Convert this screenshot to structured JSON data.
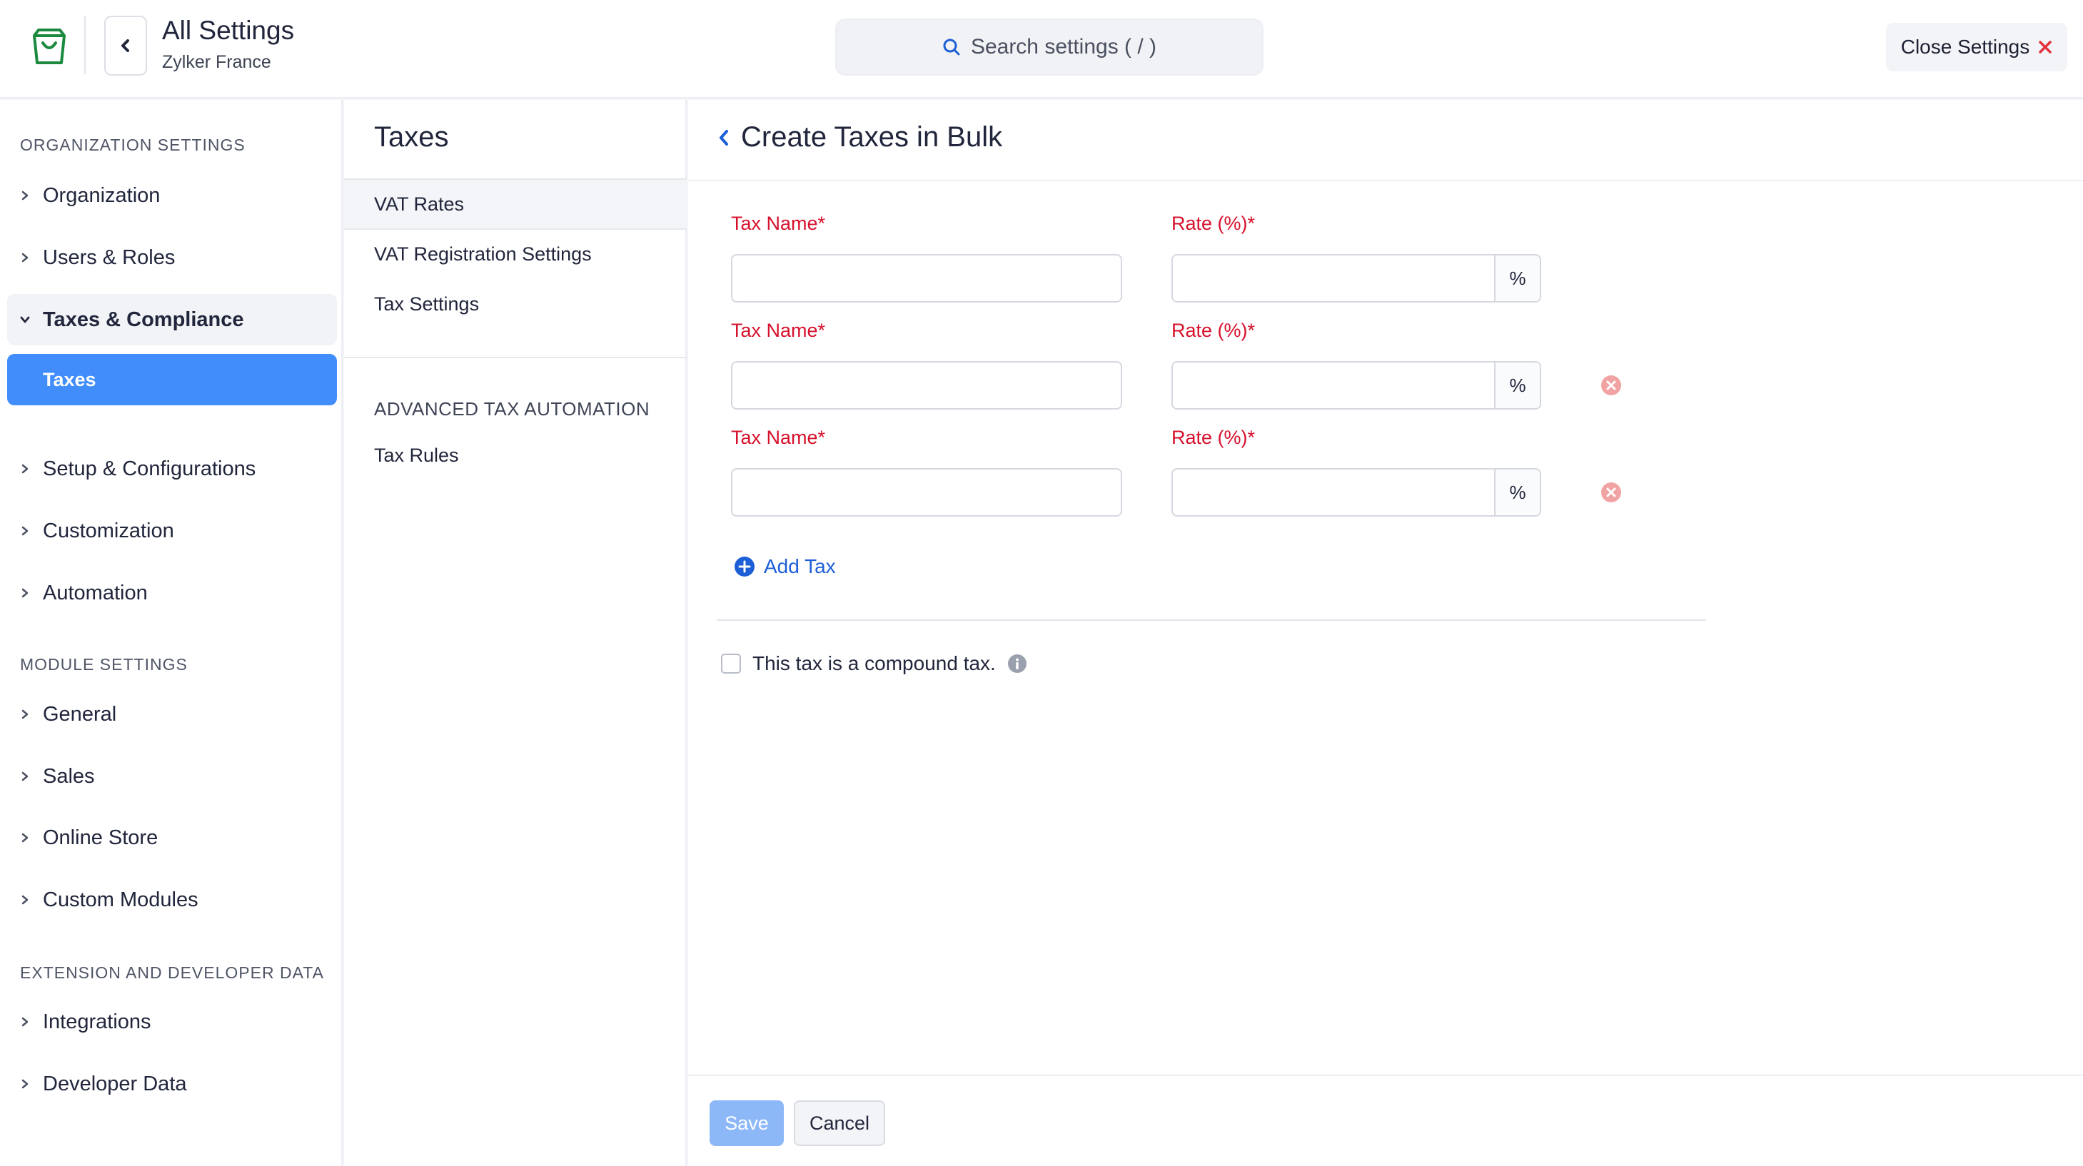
{
  "header": {
    "title": "All Settings",
    "org": "Zylker France",
    "search_placeholder": "Search settings ( / )",
    "close_label": "Close Settings",
    "logo_icon": "shopping-bag-icon",
    "brand_color": "#1b8a3e"
  },
  "sidebar": {
    "sections": [
      {
        "heading": "ORGANIZATION SETTINGS",
        "items": [
          "Organization",
          "Users & Roles",
          "Taxes & Compliance"
        ]
      },
      {
        "items": [
          "Setup & Configurations",
          "Customization",
          "Automation"
        ]
      },
      {
        "heading": "MODULE SETTINGS",
        "items": [
          "General",
          "Sales",
          "Online Store",
          "Custom Modules"
        ]
      },
      {
        "heading": "EXTENSION AND DEVELOPER DATA",
        "items": [
          "Integrations",
          "Developer Data"
        ]
      }
    ],
    "active_sub": "Taxes",
    "accent": "#408dfb"
  },
  "middle": {
    "title": "Taxes",
    "items": [
      "VAT Rates",
      "VAT Registration Settings",
      "Tax Settings"
    ],
    "selected": "VAT Rates",
    "section_heading": "ADVANCED TAX AUTOMATION",
    "section_items": [
      "Tax Rules"
    ]
  },
  "main": {
    "title": "Create Taxes in Bulk",
    "tax_name_label": "Tax Name*",
    "rate_label": "Rate (%)*",
    "unit": "%",
    "rows": [
      {
        "tax_name": "",
        "rate": "",
        "removable": false
      },
      {
        "tax_name": "",
        "rate": "",
        "removable": true
      },
      {
        "tax_name": "",
        "rate": "",
        "removable": true
      }
    ],
    "add_tax_label": "Add Tax",
    "compound_label": "This tax is a compound tax.",
    "compound_checked": false,
    "required_color": "#d6112c",
    "link_color": "#1d5fd6"
  },
  "footer": {
    "save_label": "Save",
    "cancel_label": "Cancel"
  }
}
